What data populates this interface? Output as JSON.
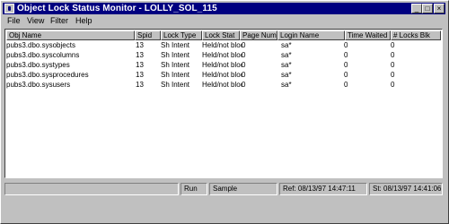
{
  "window": {
    "title": "Object Lock Status Monitor - LOLLY_SOL_115",
    "minimize_glyph": "_",
    "maximize_glyph": "□",
    "close_glyph": "×"
  },
  "menu": {
    "items": [
      "File",
      "View",
      "Filter",
      "Help"
    ]
  },
  "table": {
    "columns": [
      "Obj Name",
      "Spid",
      "Lock Type",
      "Lock Stat",
      "Page Num",
      "Login Name",
      "Time Waited",
      "# Locks Blk"
    ],
    "rows": [
      [
        "pubs3.dbo.sysobjects",
        "13",
        "Sh Intent",
        "Held/not blocked",
        "0",
        "sa*",
        "0",
        "0"
      ],
      [
        "pubs3.dbo.syscolumns",
        "13",
        "Sh Intent",
        "Held/not blocked",
        "0",
        "sa*",
        "0",
        "0"
      ],
      [
        "pubs3.dbo.systypes",
        "13",
        "Sh Intent",
        "Held/not blocked",
        "0",
        "sa*",
        "0",
        "0"
      ],
      [
        "pubs3.dbo.sysprocedures",
        "13",
        "Sh Intent",
        "Held/not blocked",
        "0",
        "sa*",
        "0",
        "0"
      ],
      [
        "pubs3.dbo.sysusers",
        "13",
        "Sh Intent",
        "Held/not blocked",
        "0",
        "sa*",
        "0",
        "0"
      ]
    ]
  },
  "statusbar": {
    "run_label": "Run",
    "sample_label": "Sample",
    "ref_text": "Ref: 08/13/97 14:47:11",
    "st_text": "St: 08/13/97 14:41:06"
  }
}
